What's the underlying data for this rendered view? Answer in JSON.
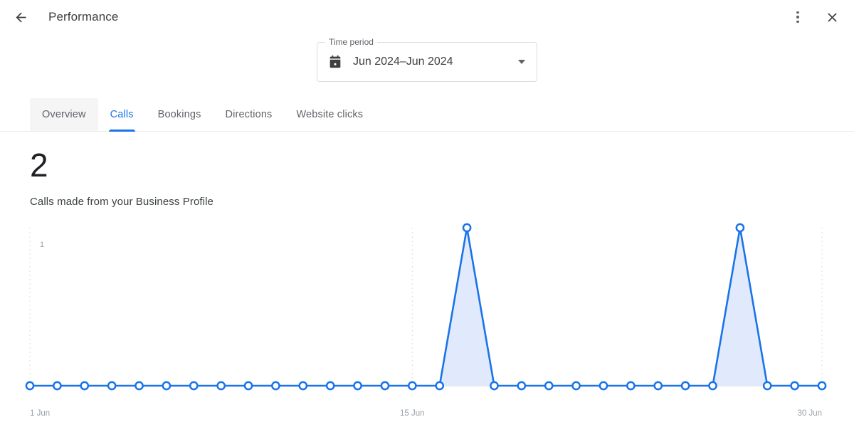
{
  "header": {
    "back_icon": "arrow-left-icon",
    "title": "Performance",
    "menu_icon": "more-vert-icon",
    "close_icon": "close-icon"
  },
  "time_period": {
    "legend": "Time period",
    "calendar_icon": "calendar-icon",
    "value": "Jun 2024–Jun 2024",
    "dropdown_icon": "chevron-down-icon"
  },
  "tabs": [
    {
      "label": "Overview",
      "active": false
    },
    {
      "label": "Calls",
      "active": true
    },
    {
      "label": "Bookings",
      "active": false
    },
    {
      "label": "Directions",
      "active": false
    },
    {
      "label": "Website clicks",
      "active": false
    }
  ],
  "metric": {
    "value": "2",
    "label": "Calls made from your Business Profile"
  },
  "colors": {
    "accent": "#1a73e8",
    "area_fill": "#e1eafc",
    "gridline": "#dadce0",
    "text_primary": "#202124",
    "text_secondary": "#5f6368",
    "axis_text": "#9aa0a6"
  },
  "chart_data": {
    "type": "line",
    "title": "Calls made from your Business Profile",
    "xlabel": "",
    "ylabel": "",
    "ylim": [
      0,
      1
    ],
    "grid": true,
    "legend": null,
    "y_ticks": [
      "1"
    ],
    "y_tick_values": [
      1
    ],
    "x_tick_labels": [
      "1 Jun",
      "15 Jun",
      "30 Jun"
    ],
    "x_tick_indices": [
      0,
      14,
      29
    ],
    "categories": [
      "1 Jun",
      "2 Jun",
      "3 Jun",
      "4 Jun",
      "5 Jun",
      "6 Jun",
      "7 Jun",
      "8 Jun",
      "9 Jun",
      "10 Jun",
      "11 Jun",
      "12 Jun",
      "13 Jun",
      "14 Jun",
      "15 Jun",
      "16 Jun",
      "17 Jun",
      "18 Jun",
      "19 Jun",
      "20 Jun",
      "21 Jun",
      "22 Jun",
      "23 Jun",
      "24 Jun",
      "25 Jun",
      "26 Jun",
      "27 Jun",
      "28 Jun",
      "29 Jun",
      "30 Jun"
    ],
    "values": [
      0,
      0,
      0,
      0,
      0,
      0,
      0,
      0,
      0,
      0,
      0,
      0,
      0,
      0,
      0,
      0,
      1,
      0,
      0,
      0,
      0,
      0,
      0,
      0,
      0,
      0,
      1,
      0,
      0,
      0
    ],
    "series": [
      {
        "name": "Calls",
        "values": [
          0,
          0,
          0,
          0,
          0,
          0,
          0,
          0,
          0,
          0,
          0,
          0,
          0,
          0,
          0,
          0,
          1,
          0,
          0,
          0,
          0,
          0,
          0,
          0,
          0,
          0,
          1,
          0,
          0,
          0
        ]
      }
    ],
    "total": 2,
    "markers": true,
    "marker_style": "hollow-circle"
  }
}
